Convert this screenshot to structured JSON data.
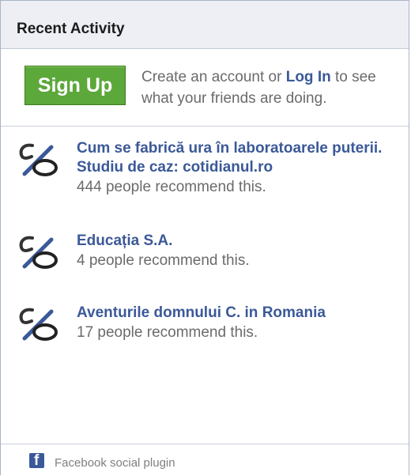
{
  "header": {
    "title": "Recent Activity"
  },
  "signup": {
    "button_label": "Sign Up",
    "text_before": "Create an account or ",
    "login_label": "Log In",
    "text_after": " to see what your friends are doing."
  },
  "activities": [
    {
      "title": "Cum se fabrică ura în laboratoarele puterii. Studiu de caz: cotidianul.ro",
      "count": "444 people recommend this.",
      "icon": "recommend-icon"
    },
    {
      "title": "Educația S.A.",
      "count": "4 people recommend this.",
      "icon": "recommend-icon"
    },
    {
      "title": "Aventurile domnului C. in Romania",
      "count": "17 people recommend this.",
      "icon": "recommend-icon"
    }
  ],
  "footer": {
    "label": "Facebook social plugin",
    "icon": "facebook-icon"
  },
  "colors": {
    "link": "#3b5998",
    "signup_green": "#5ca83a",
    "header_bg": "#edeff4",
    "muted_text": "#6b6b6b"
  }
}
